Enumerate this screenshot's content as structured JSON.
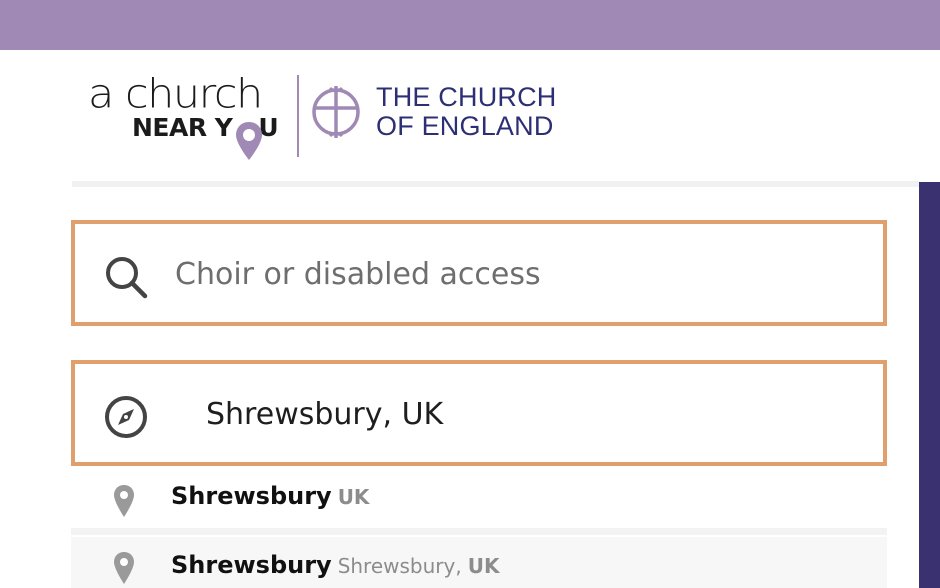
{
  "brand": {
    "acny_line1": "a church",
    "acny_line2_a": "NEAR Y",
    "acny_line2_b": "U",
    "coe_line1": "THE CHURCH",
    "coe_line2": "OF ENGLAND",
    "colors": {
      "top_bar": "#a08ab5",
      "accent_border": "#dfa06e",
      "coe_navy": "#2d2f75",
      "side_bar": "#3a3270"
    }
  },
  "search": {
    "placeholder": "Choir or disabled access",
    "icon": "search-icon"
  },
  "location": {
    "value": "Shrewsbury, UK",
    "icon": "compass-icon"
  },
  "suggestions": [
    {
      "name": "Shrewsbury",
      "detail": "",
      "country": "UK",
      "icon": "map-pin-icon"
    },
    {
      "name": "Shrewsbury",
      "detail": "Shrewsbury,",
      "country": "UK",
      "icon": "map-pin-icon"
    }
  ]
}
